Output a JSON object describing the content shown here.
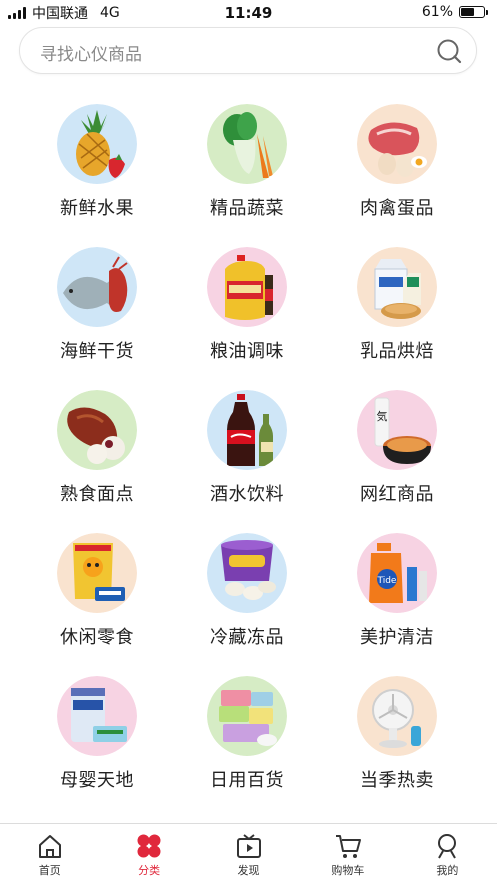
{
  "status_bar": {
    "carrier": "中国联通",
    "network": "4G",
    "time": "11:49",
    "battery": "61%",
    "battery_level": 0.61
  },
  "search": {
    "placeholder": "寻找心仪商品",
    "icon": "search-icon"
  },
  "categories": [
    {
      "label": "新鲜水果",
      "icon": "pineapple-strawberry-image",
      "bg": "#cfe6f7"
    },
    {
      "label": "精品蔬菜",
      "icon": "bok-choy-carrot-image",
      "bg": "#d6ecc5"
    },
    {
      "label": "肉禽蛋品",
      "icon": "meat-eggs-image",
      "bg": "#f9e3cf"
    },
    {
      "label": "海鲜干货",
      "icon": "fish-lobster-image",
      "bg": "#cfe6f7"
    },
    {
      "label": "粮油调味",
      "icon": "cooking-oil-image",
      "bg": "#f7d3e3"
    },
    {
      "label": "乳品烘焙",
      "icon": "milk-bread-image",
      "bg": "#f9e3cf"
    },
    {
      "label": "熟食面点",
      "icon": "roast-duck-image",
      "bg": "#d6ecc5"
    },
    {
      "label": "酒水饮料",
      "icon": "cola-bottle-image",
      "bg": "#cfe6f7"
    },
    {
      "label": "网红商品",
      "icon": "instant-noodle-image",
      "bg": "#f7d3e3"
    },
    {
      "label": "休闲零食",
      "icon": "snack-bag-image",
      "bg": "#f9e3cf"
    },
    {
      "label": "冷藏冻品",
      "icon": "frozen-dumplings-image",
      "bg": "#cfe6f7"
    },
    {
      "label": "美护清洁",
      "icon": "detergent-image",
      "bg": "#f7d3e3"
    },
    {
      "label": "母婴天地",
      "icon": "milk-powder-image",
      "bg": "#f7d3e3"
    },
    {
      "label": "日用百货",
      "icon": "storage-boxes-image",
      "bg": "#d6ecc5"
    },
    {
      "label": "当季热卖",
      "icon": "fan-image",
      "bg": "#f9e3cf"
    }
  ],
  "tabs": [
    {
      "label": "首页",
      "icon": "home-icon",
      "active": false
    },
    {
      "label": "分类",
      "icon": "category-icon",
      "active": true
    },
    {
      "label": "发现",
      "icon": "video-icon",
      "active": false
    },
    {
      "label": "购物车",
      "icon": "cart-icon",
      "active": false
    },
    {
      "label": "我的",
      "icon": "user-icon",
      "active": false
    }
  ],
  "colors": {
    "accent": "#e0283c",
    "text": "#222222",
    "placeholder": "#8a8a8a"
  }
}
